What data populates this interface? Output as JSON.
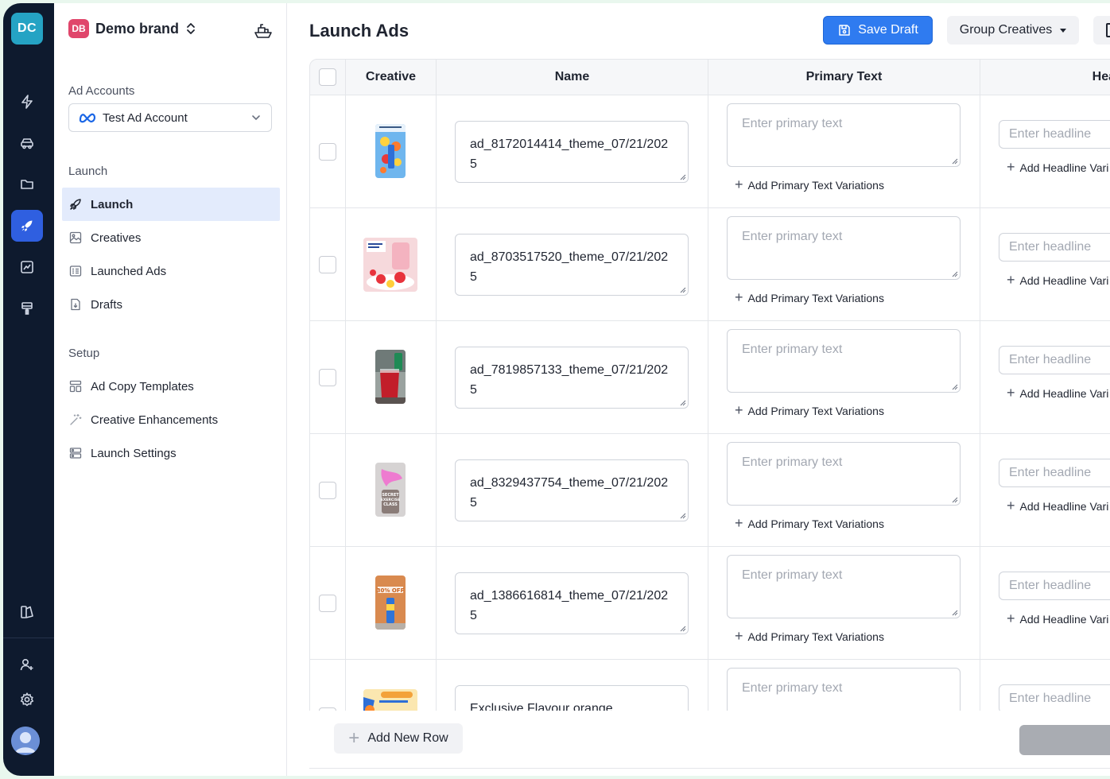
{
  "rail": {
    "logo": "DC",
    "items": [
      "lightning-icon",
      "car-icon",
      "folder-icon",
      "rocket-icon",
      "chart-icon",
      "paint-roller-icon",
      "theme-icon",
      "user-add-icon",
      "gear-icon",
      "avatar"
    ],
    "active": "rocket-icon"
  },
  "brand": {
    "badge": "DB",
    "name": "Demo brand",
    "caret": "⌃⌄"
  },
  "sidebar": {
    "ad_accounts_label": "Ad Accounts",
    "account": "Test Ad Account",
    "launch_label": "Launch",
    "launch_items": [
      {
        "label": "Launch",
        "icon": "rocket-icon",
        "active": true
      },
      {
        "label": "Creatives",
        "icon": "image-icon"
      },
      {
        "label": "Launched Ads",
        "icon": "list-icon"
      },
      {
        "label": "Drafts",
        "icon": "draft-icon"
      }
    ],
    "setup_label": "Setup",
    "setup_items": [
      {
        "label": "Ad Copy Templates",
        "icon": "template-icon"
      },
      {
        "label": "Creative Enhancements",
        "icon": "magic-wand-icon"
      },
      {
        "label": "Launch Settings",
        "icon": "settings-list-icon"
      }
    ]
  },
  "header": {
    "title": "Launch Ads",
    "save_label": "Save Draft",
    "group_label": "Group Creatives"
  },
  "table": {
    "columns": [
      "Creative",
      "Name",
      "Primary Text",
      "Hea"
    ],
    "primary_placeholder": "Enter primary text",
    "add_primary_label": "Add Primary Text Variations",
    "headline_placeholder": "Enter headline",
    "add_headline_label": "Add Headline Vari",
    "rows": [
      {
        "name": "ad_8172014414_theme_07/21/2025",
        "thumb": "blue-fruit"
      },
      {
        "name": "ad_8703517520_theme_07/21/2025",
        "thumb": "pink-strawberry"
      },
      {
        "name": "ad_7819857133_theme_07/21/2025",
        "thumb": "red-drink"
      },
      {
        "name": "ad_8329437754_theme_07/21/2025",
        "thumb": "pink-wave"
      },
      {
        "name": "ad_1386616814_theme_07/21/2025",
        "thumb": "orange-promo"
      },
      {
        "name": "Exclusive Flavour orange",
        "thumb": "yellow-promo"
      }
    ],
    "thumb_texts": {
      "row4": "SECRET EXERCISE CLASS",
      "row5": "30% OFF"
    }
  },
  "footer": {
    "add_row_label": "Add New Row",
    "add_row_icon": "+"
  },
  "colors": {
    "accent": "#2f7bf0",
    "rail": "#0e1a2e",
    "active_nav": "#e3ebfc",
    "brand_badge": "#e0466b"
  }
}
